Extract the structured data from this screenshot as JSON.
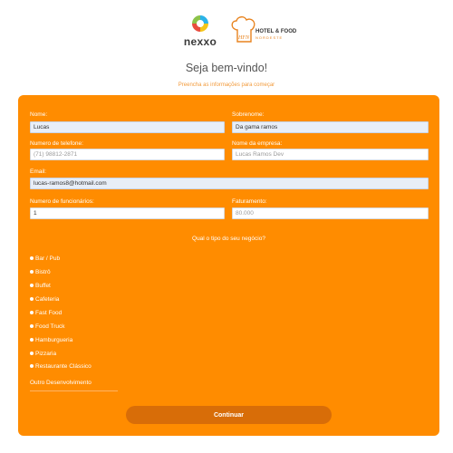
{
  "brand": {
    "nexxo_name": "nexxo",
    "partner_title": "HOTEL & FOOD",
    "partner_sub": "NORDESTE",
    "partner_initials": "HFN"
  },
  "header": {
    "welcome": "Seja bem-vindo!",
    "hint": "Preencha as informações para começar"
  },
  "form": {
    "nome": {
      "label": "Nome:",
      "value": "Lucas"
    },
    "sobrenome": {
      "label": "Sobrenome:",
      "value": "Da gama ramos"
    },
    "telefone": {
      "label": "Numero de telefone:",
      "placeholder": "(71) 98812-2871"
    },
    "empresa": {
      "label": "Nome da empresa:",
      "placeholder": "Lucas Ramos Dev"
    },
    "email": {
      "label": "Email:",
      "value": "lucas-ramos8@hotmail.com"
    },
    "funcionarios": {
      "label": "Numero de funcionários:",
      "value": "1"
    },
    "faturamento": {
      "label": "Faturamento:",
      "placeholder": "80.000"
    }
  },
  "business": {
    "question": "Qual o tipo do seu negócio?",
    "options": [
      "Bar / Pub",
      "Bistrô",
      "Buffet",
      "Cafeteria",
      "Fast Food",
      "Food Truck",
      "Hamburgueria",
      "Pizzaria",
      "Restaurante Clássico"
    ],
    "other_label": "Outro Desenvolvimento"
  },
  "actions": {
    "continue_label": "Continuar"
  },
  "colors": {
    "accent": "#ff8c00",
    "button": "#d86d08"
  }
}
